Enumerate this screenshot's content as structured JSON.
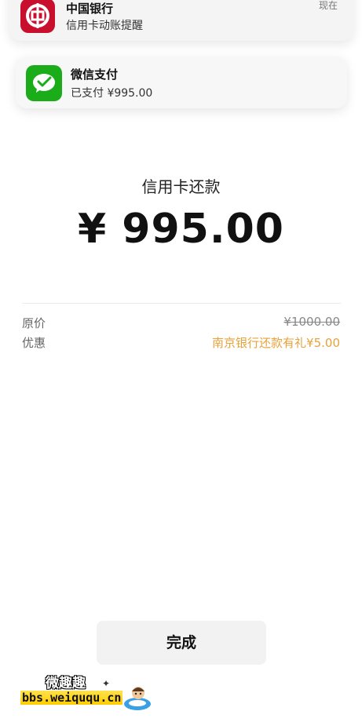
{
  "notifications": {
    "bank": {
      "icon": "bank-of-china-icon",
      "title": "中国银行",
      "body": "信用卡动账提醒",
      "time": "现在"
    },
    "wechat": {
      "icon": "wechat-pay-icon",
      "title": "微信支付",
      "body": "已支付 ¥995.00"
    }
  },
  "payment": {
    "title": "信用卡还款",
    "amount": "¥ 995.00",
    "rows": [
      {
        "label": "原价",
        "value": "¥1000.00"
      },
      {
        "label": "优惠",
        "value": "南京银行还款有礼¥5.00"
      }
    ]
  },
  "done_button": "完成",
  "watermark": {
    "name": "微趣趣",
    "url": "bbs.weiququ.cn"
  },
  "colors": {
    "discount": "#e7a23a",
    "wechat_green": "#1aad19",
    "boc_red": "#c8102e"
  }
}
